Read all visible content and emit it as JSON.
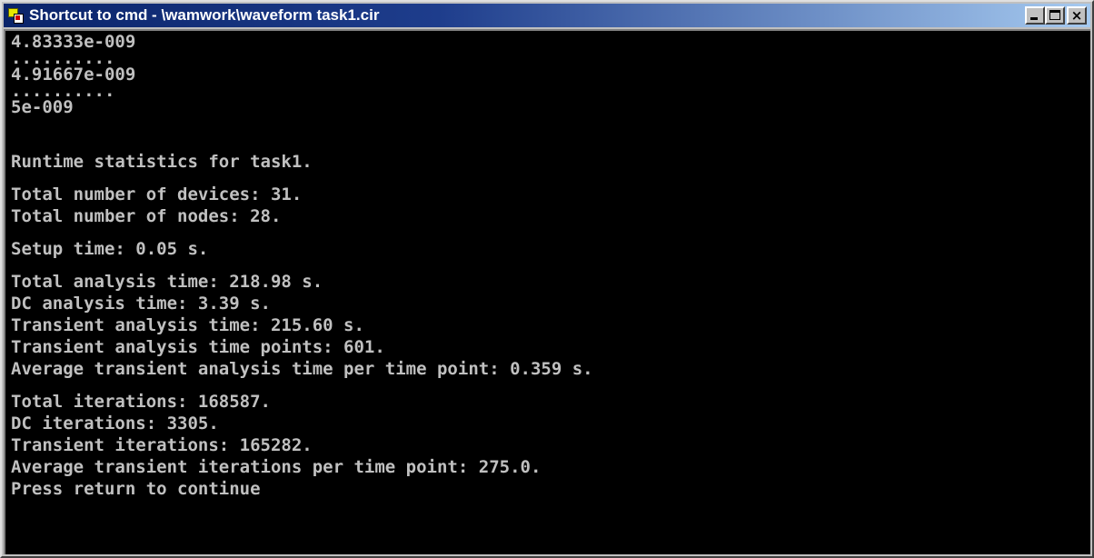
{
  "window": {
    "title": "Shortcut to cmd - \\wamwork\\waveform task1.cir",
    "icon": "ms-dos-icon",
    "buttons": [
      "minimize",
      "maximize",
      "close"
    ]
  },
  "console": {
    "foreground": "#c0c0c0",
    "background": "#000000",
    "lines": [
      "4.83333e-009",
      "..........",
      "4.91667e-009",
      "..........",
      "5e-009",
      "",
      "",
      "Runtime statistics for task1.",
      "",
      "Total number of devices: 31.",
      "Total number of nodes: 28.",
      "",
      "Setup time: 0.05 s.",
      "",
      "Total analysis time: 218.98 s.",
      "DC analysis time: 3.39 s.",
      "Transient analysis time: 215.60 s.",
      "Transient analysis time points: 601.",
      "Average transient analysis time per time point: 0.359 s.",
      "",
      "Total iterations: 168587.",
      "DC iterations: 3305.",
      "Transient iterations: 165282.",
      "Average transient iterations per time point: 275.0.",
      "Press return to continue"
    ]
  }
}
